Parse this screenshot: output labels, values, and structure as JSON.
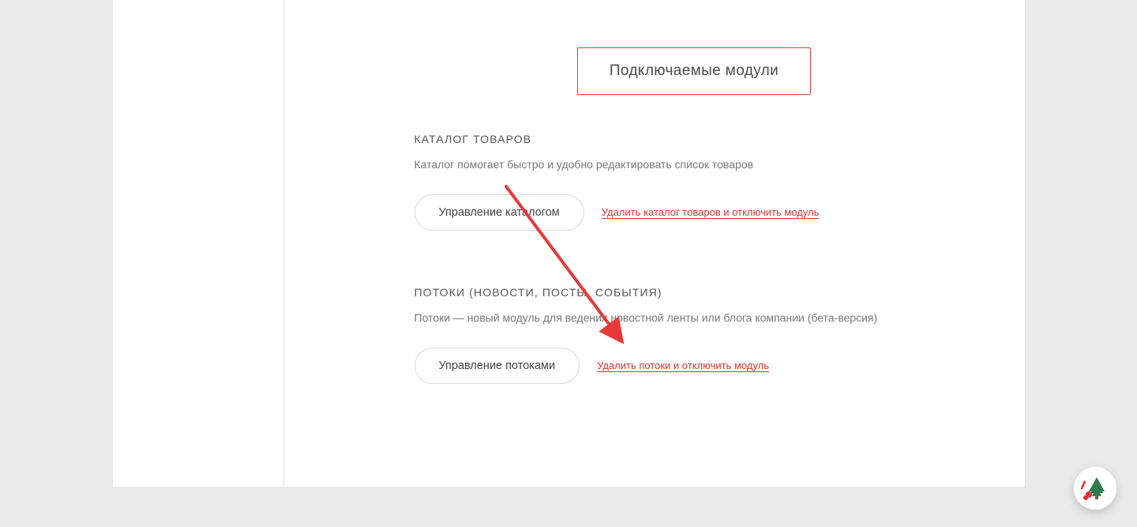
{
  "tab_label": "Подключаемые модули",
  "modules": {
    "catalog": {
      "title": "КАТАЛОГ ТОВАРОВ",
      "description": "Каталог помогает быстро и удобно редактировать список товаров",
      "manage_label": "Управление каталогом",
      "remove_label": "Удалить каталог товаров и отключить модуль"
    },
    "streams": {
      "title": "ПОТОКИ (НОВОСТИ, ПОСТЫ, СОБЫТИЯ)",
      "description": "Потоки — новый модуль для ведения новостной ленты или блога компании (бета-версия)",
      "manage_label": "Управление потоками",
      "remove_label": "Удалить потоки и отключить модуль"
    }
  }
}
